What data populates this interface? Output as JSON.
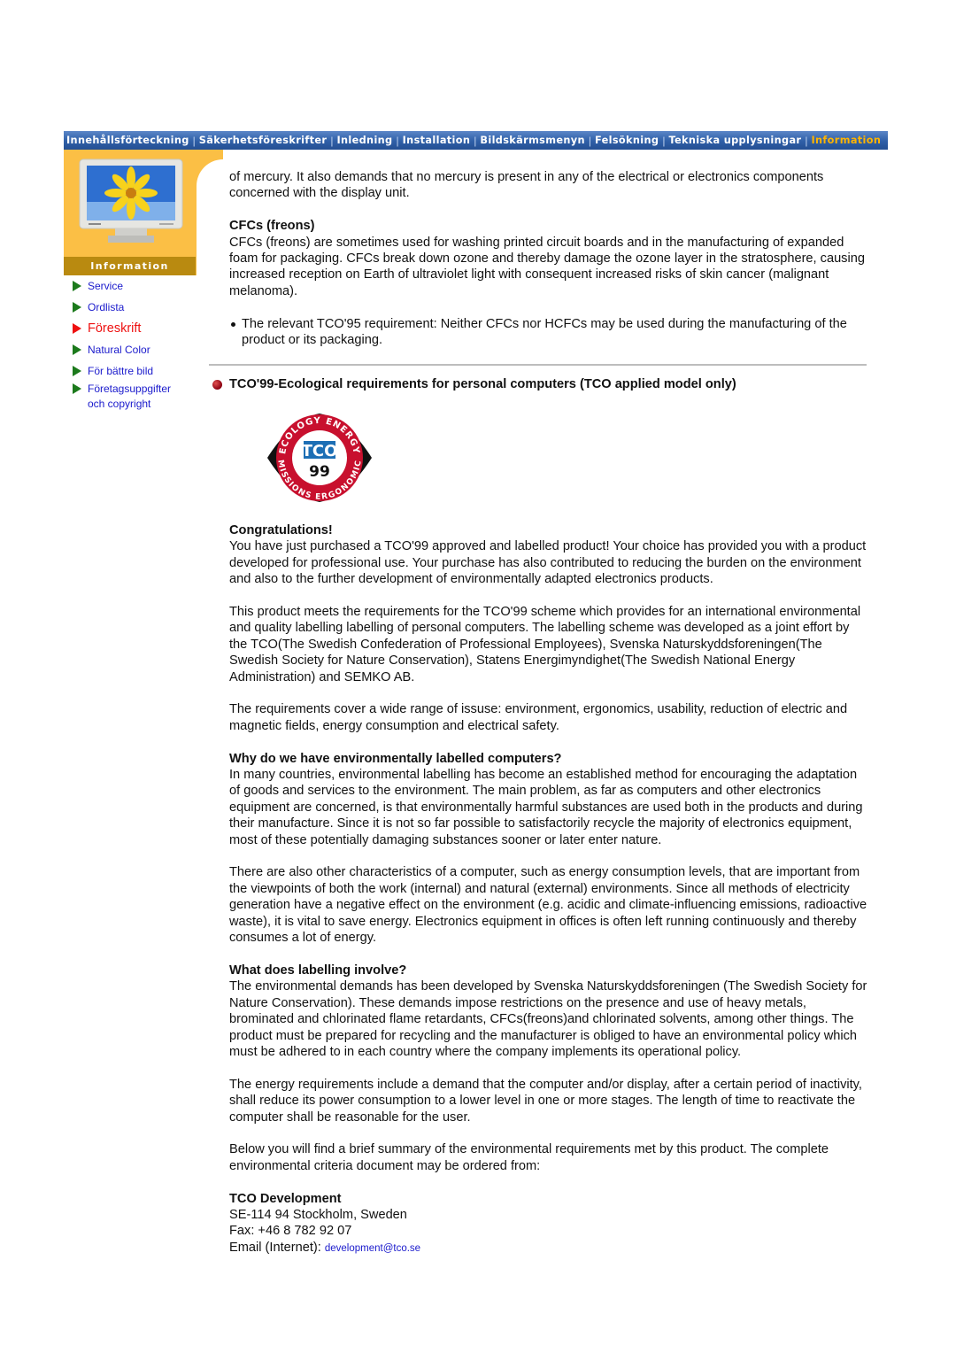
{
  "nav": {
    "items": [
      {
        "label": "Innehållsförteckning",
        "active": false
      },
      {
        "label": "Säkerhetsföreskrifter",
        "active": false
      },
      {
        "label": "Inledning",
        "active": false
      },
      {
        "label": "Installation",
        "active": false
      },
      {
        "label": "Bildskärmsmenyn",
        "active": false
      },
      {
        "label": "Felsökning",
        "active": false
      },
      {
        "label": "Tekniska upplysningar",
        "active": false
      },
      {
        "label": "Information",
        "active": true
      }
    ],
    "separator": "|"
  },
  "sidebar": {
    "banner_label": "Information",
    "items": [
      {
        "label": "Service"
      },
      {
        "label": "Ordlista"
      },
      {
        "label": "Föreskrift",
        "active": true
      },
      {
        "label": "Natural Color"
      },
      {
        "label": "För bättre bild"
      },
      {
        "label": "Företagsuppgifter och copyright"
      }
    ]
  },
  "intro": {
    "mercury_text": "of mercury. It also demands that no mercury is present in any of the electrical or electronics components concerned with the display unit.",
    "cfc_heading": "CFCs (freons)",
    "cfc_text": "CFCs (freons) are sometimes used for washing printed circuit boards and in the manufacturing of expanded foam for packaging. CFCs break down ozone and thereby damage the ozone layer in the stratosphere, causing increased reception on Earth of ultraviolet light with consequent increased risks of skin cancer (malignant melanoma).",
    "cfc_requirement": "The relevant TCO'95 requirement: Neither CFCs nor HCFCs may be used during the manufacturing of the product or its packaging."
  },
  "tco99": {
    "heading": "TCO'99-Ecological requirements for personal computers (TCO applied model only)",
    "logo": {
      "top_text": "ECOLOGY ENERGY",
      "bottom_text": "EMISSIONS ERGONOMICS",
      "brand": "TCO",
      "number": "99"
    },
    "congrats_heading": "Congratulations!",
    "congrats_text": "You have just purchased a TCO'99 approved and labelled product! Your choice has provided you with a product developed for professional use. Your purchase has also contributed to reducing the burden on the environment and also to the further development of environmentally adapted electronics products.",
    "scheme_text": "This product meets the requirements for the TCO'99 scheme which provides for an international environmental and quality labelling labelling of personal computers. The labelling scheme was developed as a joint effort by the TCO(The Swedish Confederation of Professional Employees), Svenska Naturskyddsforeningen(The Swedish Society for Nature Conservation), Statens Energimyndighet(The Swedish National Energy Administration) and SEMKO AB.",
    "range_text": "The requirements cover a wide range of issuse: environment, ergonomics, usability, reduction of electric and magnetic fields, energy consumption and electrical safety.",
    "why_heading": "Why do we have environmentally labelled computers?",
    "why_text": "In many countries, environmental labelling has become an established method for encouraging the adaptation of goods and services to the environment. The main problem, as far as computers and other electronics equipment are concerned, is that environmentally harmful substances are used both in the products and during their manufacture. Since it is not so far possible to satisfactorily recycle the majority of electronics equipment, most of these potentially damaging substances sooner or later enter nature.",
    "energy_text": "There are also other characteristics of a computer, such as energy consumption levels, that are important from the viewpoints of both the work (internal) and natural (external) environments. Since all methods of electricity generation have a negative effect on the environment (e.g. acidic and climate-influencing emissions, radioactive waste), it is vital to save energy. Electronics equipment in offices is often left running continuously and thereby consumes a lot of energy.",
    "involve_heading": "What does labelling involve?",
    "involve_text": "The environmental demands has been developed by Svenska Naturskyddsforeningen (The Swedish Society for Nature Conservation). These demands impose restrictions on the presence and use of heavy metals, brominated and chlorinated flame retardants, CFCs(freons)and chlorinated solvents, among other things. The product must be prepared for recycling and the manufacturer is obliged to have an environmental policy which must be adhered to in each country where the company implements its operational policy.",
    "energy_req_text": "The energy requirements include a demand that the computer and/or display, after a certain period of inactivity, shall reduce its power consumption to a lower level in one or more stages. The length of time to reactivate the computer shall be reasonable for the user.",
    "summary_text": "Below you will find a brief summary of the environmental requirements met by this product. The complete environmental criteria document may be ordered from:"
  },
  "contact": {
    "name": "TCO Development",
    "address": "SE-114 94 Stockholm, Sweden",
    "fax": "Fax: +46 8 782 92 07",
    "email_label": "Email (Internet): ",
    "email": "development@tco.se"
  },
  "colors": {
    "nav_bg": "#2f5fa7",
    "nav_active": "#ffb400",
    "sidebar_orange": "#fbbf45",
    "banner_gold": "#b98a10",
    "link_blue": "#1a1acc",
    "active_red": "#ee1111",
    "arrow_green": "#1c7a1c"
  }
}
